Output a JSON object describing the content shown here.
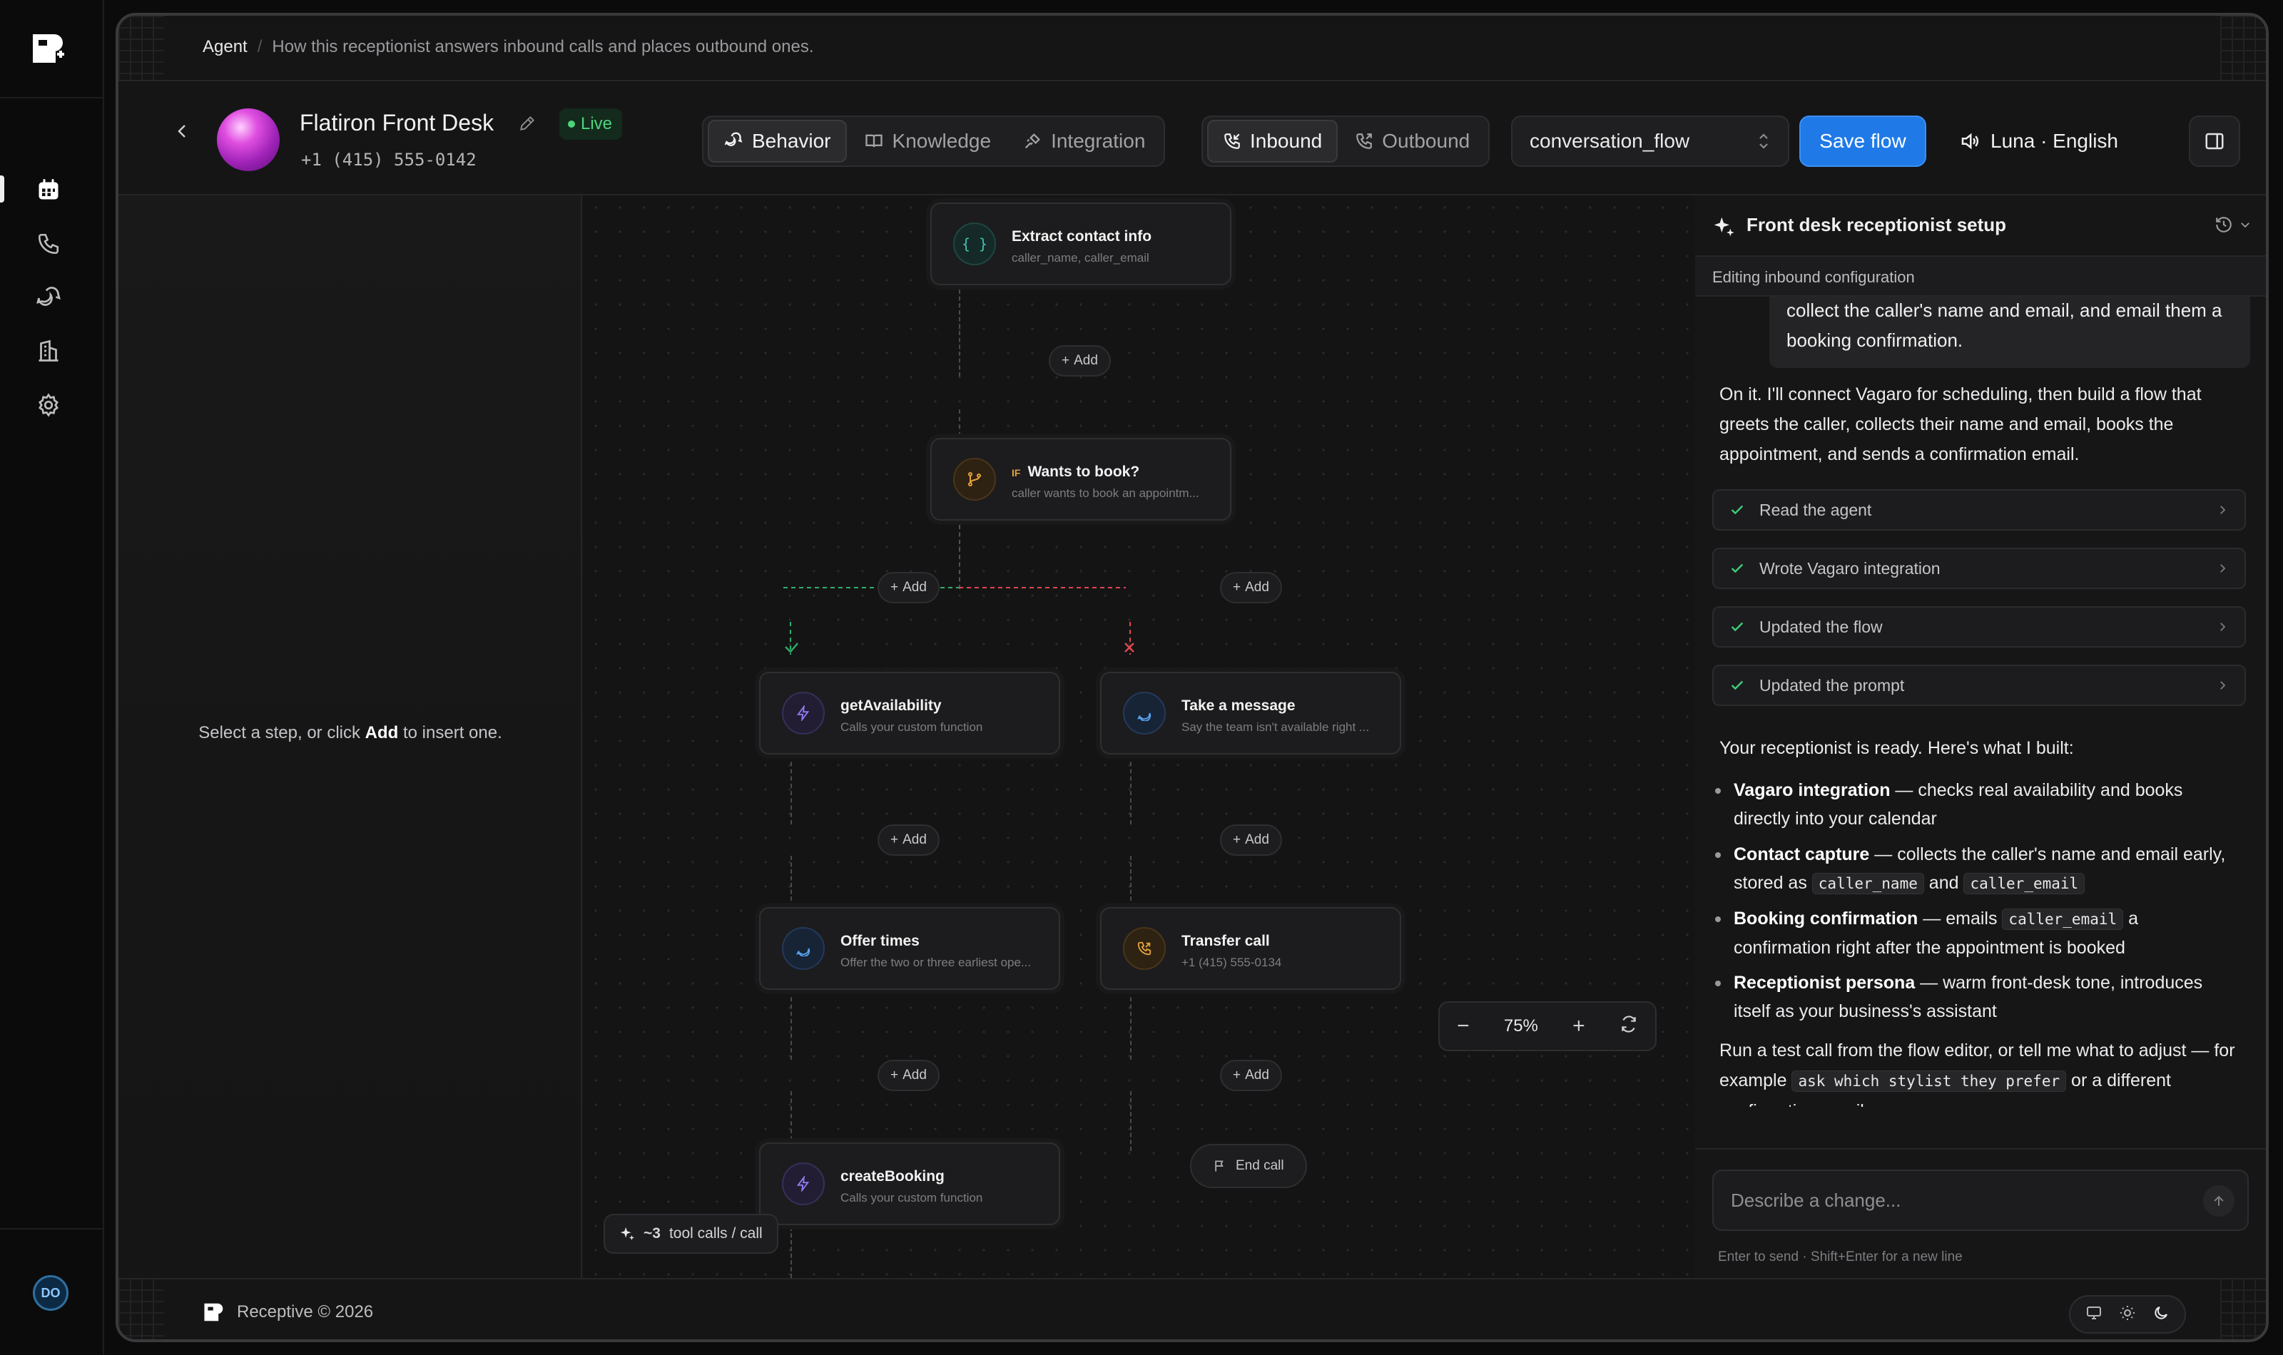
{
  "breadcrumb": {
    "root": "Agent",
    "current": "How this receptionist answers inbound calls and places outbound ones."
  },
  "agent": {
    "name": "Flatiron Front Desk",
    "status": "Live",
    "phone": "+1 (415) 555-0142"
  },
  "tabs": {
    "behavior": "Behavior",
    "knowledge": "Knowledge",
    "integration": "Integration"
  },
  "direction": {
    "inbound": "Inbound",
    "outbound": "Outbound"
  },
  "flow_select": {
    "value": "conversation_flow"
  },
  "save_label": "Save flow",
  "voice": {
    "label": "Luna · English"
  },
  "left_pane": {
    "hint_pre": "Select a step, or click ",
    "hint_bold": "Add",
    "hint_post": " to insert one."
  },
  "flow": {
    "add_label": "Add",
    "nodes": {
      "extract": {
        "title": "Extract contact info",
        "sub": "caller_name, caller_email"
      },
      "wants": {
        "tag": "IF",
        "title": "Wants to book?",
        "sub": "caller wants to book an appointm..."
      },
      "getavail": {
        "title": "getAvailability",
        "sub": "Calls your custom function"
      },
      "message": {
        "title": "Take a message",
        "sub": "Say the team isn't available right ..."
      },
      "offer": {
        "title": "Offer times",
        "sub": "Offer the two or three earliest ope..."
      },
      "transfer": {
        "title": "Transfer call",
        "sub": "+1 (415) 555-0134"
      },
      "create": {
        "title": "createBooking",
        "sub": "Calls your custom function"
      },
      "end": {
        "title": "End call"
      }
    },
    "zoom": "75%",
    "tool_calls": {
      "count": "~3",
      "label": "tool calls / call"
    }
  },
  "chat": {
    "title": "Front desk receptionist setup",
    "subtitle": "Editing inbound configuration",
    "user_message": "collect the caller's name and email, and email them a booking confirmation.",
    "intro": "On it. I'll connect Vagaro for scheduling, then build a flow that greets the caller, collects their name and email, books the appointment, and sends a confirmation email.",
    "steps": [
      "Read the agent",
      "Wrote Vagaro integration",
      "Updated the flow",
      "Updated the prompt"
    ],
    "ready": "Your receptionist is ready. Here's what I built:",
    "bullets": [
      {
        "bold": "Vagaro integration",
        "text": " — checks real availability and books directly into your calendar"
      },
      {
        "bold": "Contact capture",
        "text": " — collects the caller's name and email early, stored as ",
        "code1": "caller_name",
        "mid": " and ",
        "code2": "caller_email"
      },
      {
        "bold": "Booking confirmation",
        "text": " — emails ",
        "code1": "caller_email",
        "mid": " a confirmation right after the appointment is booked"
      },
      {
        "bold": "Receptionist persona",
        "text": " — warm front-desk tone, introduces itself as your business's assistant"
      }
    ],
    "closing_pre": "Run a test call from the flow editor, or tell me what to adjust — for example ",
    "closing_code": "ask which stylist they prefer",
    "closing_post": " or a different confirmation email.",
    "input_placeholder": "Describe a change...",
    "input_hint": "Enter to send · Shift+Enter for a new line"
  },
  "footer": {
    "brand": "Receptive © 2026"
  },
  "user": {
    "initials": "DO"
  },
  "colors": {
    "accent": "#1f7ae8",
    "live": "#4cd67c",
    "yes_branch": "#2fae6a",
    "no_branch": "#e0474c"
  }
}
